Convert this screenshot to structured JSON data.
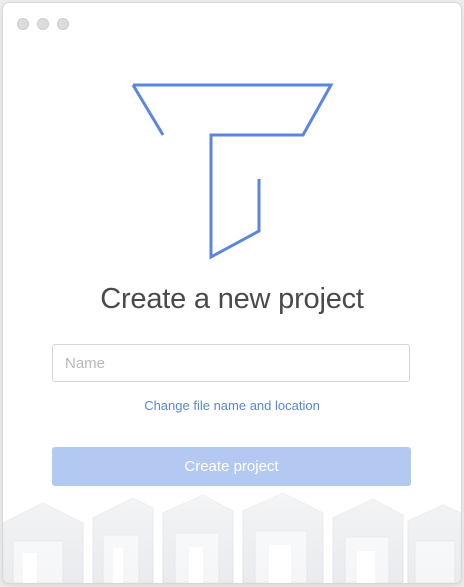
{
  "window": {
    "lights": [
      "close",
      "minimize",
      "zoom"
    ]
  },
  "logo": {
    "icon": "t-shaped-maze-logo",
    "color": "#5b86e0"
  },
  "heading": "Create a new project",
  "form": {
    "name_placeholder": "Name",
    "name_value": "",
    "change_link": "Change file name and location",
    "create_button": "Create project",
    "create_button_enabled": false
  },
  "colors": {
    "accent": "#5b86d8",
    "button_disabled": "#b4c9f2"
  }
}
